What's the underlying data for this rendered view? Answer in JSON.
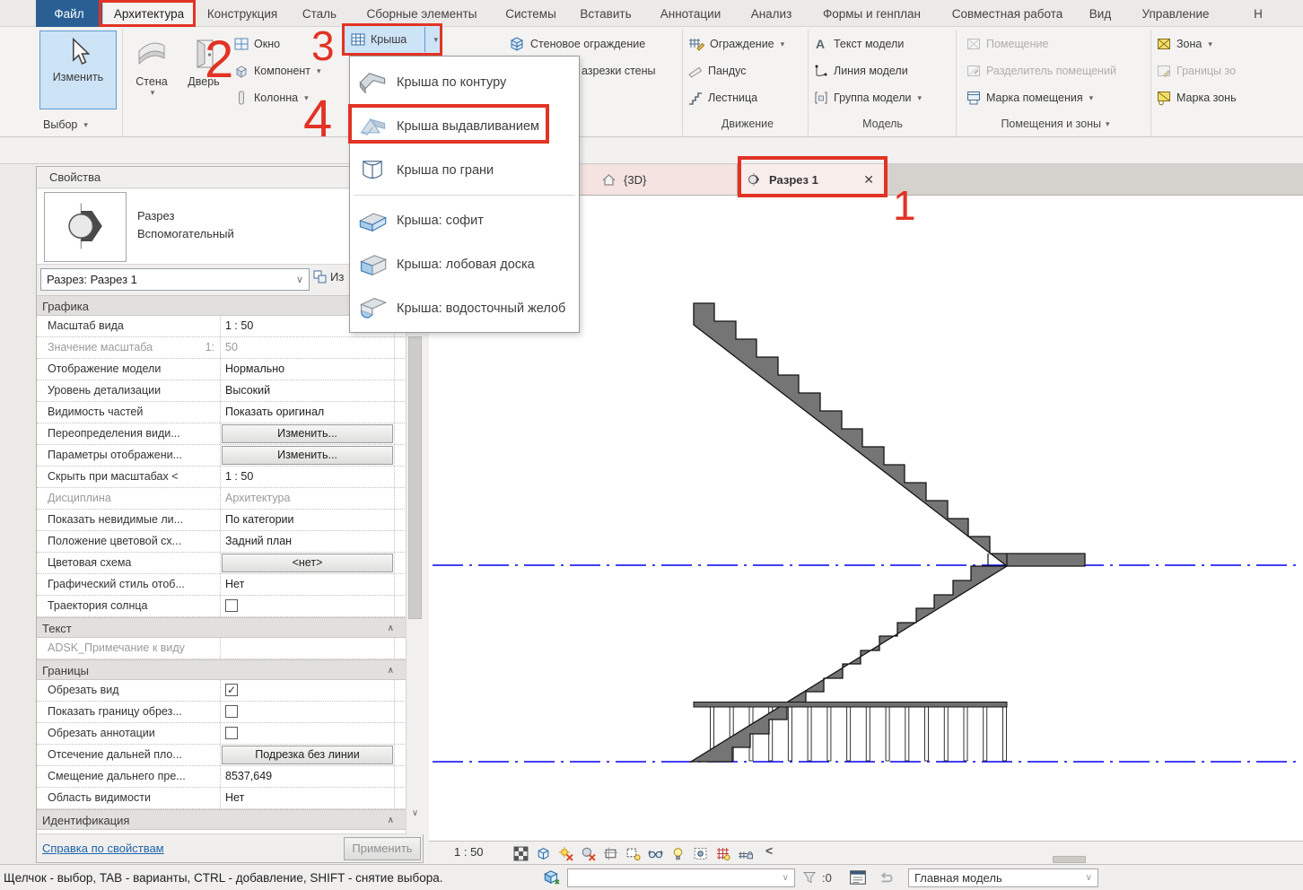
{
  "ribbon": {
    "tabs": [
      {
        "label": "Файл"
      },
      {
        "label": "Архитектура"
      },
      {
        "label": "Конструкция"
      },
      {
        "label": "Сталь"
      },
      {
        "label": "Сборные элементы"
      },
      {
        "label": "Системы"
      },
      {
        "label": "Вставить"
      },
      {
        "label": "Аннотации"
      },
      {
        "label": "Анализ"
      },
      {
        "label": "Формы и генплан"
      },
      {
        "label": "Совместная работа"
      },
      {
        "label": "Вид"
      },
      {
        "label": "Управление"
      },
      {
        "label": "Н"
      }
    ],
    "active_tab": "Архитектура",
    "modify": "Изменить",
    "selection_panel": "Выбор",
    "build": {
      "wall": "Стена",
      "door": "Дверь",
      "window": "Окно",
      "component": "Компонент",
      "column": "Колонна",
      "roof": "Крыша",
      "curtain_grid": "Стеновое ограждение",
      "wall_reveal_fragment": "азрезки стены"
    },
    "circulation": {
      "railing": "Ограждение",
      "ramp": "Пандус",
      "stair": "Лестница",
      "panel": "Движение"
    },
    "model": {
      "text": "Текст модели",
      "line": "Линия модели",
      "group": "Группа модели",
      "panel": "Модель"
    },
    "rooms": {
      "room": "Помещение",
      "separator": "Разделитель помещений",
      "room_tag": "Марка помещения",
      "panel": "Помещения и зоны",
      "zone": "Зона",
      "zone_boundary": "Границы зо",
      "zone_tag": "Марка зонь"
    }
  },
  "roof_menu": {
    "items": [
      {
        "icon": "roof-footprint",
        "label": "Крыша по контуру"
      },
      {
        "icon": "roof-extrusion",
        "label": "Крыша выдавливанием"
      },
      {
        "icon": "roof-face",
        "label": "Крыша по грани",
        "separator_after": true
      },
      {
        "icon": "roof-soffit",
        "label": "Крыша: софит"
      },
      {
        "icon": "roof-fascia",
        "label": "Крыша: лобовая доска"
      },
      {
        "icon": "roof-gutter",
        "label": "Крыша: водосточный желоб"
      }
    ]
  },
  "properties": {
    "title": "Свойства",
    "type_name": "Разрез",
    "type_style": "Вспомогательный",
    "selector": "Разрез: Разрез 1",
    "edit_type_fragment": "Из",
    "sections": [
      {
        "header": "Графика",
        "rows": [
          {
            "label": "Масштаб вида",
            "value": "1 : 50"
          },
          {
            "label": "Значение масштаба",
            "label2": "1:",
            "value": "50",
            "disabled": true
          },
          {
            "label": "Отображение модели",
            "value": "Нормально"
          },
          {
            "label": "Уровень детализации",
            "value": "Высокий"
          },
          {
            "label": "Видимость частей",
            "value": "Показать оригинал"
          },
          {
            "label": "Переопределения види...",
            "value": "Изменить...",
            "kind": "button"
          },
          {
            "label": "Параметры отображени...",
            "value": "Изменить...",
            "kind": "button"
          },
          {
            "label": "Скрыть при масштабах <",
            "value": "1 : 50"
          },
          {
            "label": "Дисциплина",
            "value": "Архитектура",
            "disabled": true
          },
          {
            "label": "Показать невидимые ли...",
            "value": "По категории"
          },
          {
            "label": "Положение цветовой сх...",
            "value": "Задний план"
          },
          {
            "label": "Цветовая схема",
            "value": "<нет>",
            "kind": "button"
          },
          {
            "label": "Графический стиль отоб...",
            "value": "Нет"
          },
          {
            "label": "Траектория солнца",
            "kind": "check",
            "checked": false
          }
        ]
      },
      {
        "header": "Текст",
        "rows": [
          {
            "label": "ADSK_Примечание к виду",
            "value": "",
            "disabled": true
          }
        ]
      },
      {
        "header": "Границы",
        "rows": [
          {
            "label": "Обрезать вид",
            "kind": "check",
            "checked": true
          },
          {
            "label": "Показать границу обрез...",
            "kind": "check",
            "checked": false
          },
          {
            "label": "Обрезать аннотации",
            "kind": "check",
            "checked": false
          },
          {
            "label": "Отсечение дальней пло...",
            "value": "Подрезка без линии",
            "kind": "button"
          },
          {
            "label": "Смещение дальнего пре...",
            "value": "8537,649"
          },
          {
            "label": "Область видимости",
            "value": "Нет"
          }
        ]
      },
      {
        "header": "Идентификация",
        "rows": []
      }
    ],
    "help_link": "Справка по свойствам",
    "apply_button": "Применить"
  },
  "view_tabs": [
    {
      "icon": "home-icon",
      "label": "{3D}"
    },
    {
      "icon": "section-icon",
      "label": "Разрез 1",
      "close": "✕",
      "active": true
    }
  ],
  "view_control_bar": {
    "scale": "1 : 50",
    "icons": [
      "crop-size",
      "visual-style",
      "sun-path-off",
      "shadows-off",
      "crop-view",
      "show-crop-region",
      "temporary-hide-isolate",
      "reveal-hidden",
      "temporary-view-properties",
      "hide-analytical",
      "view-lock"
    ],
    "collapse": "<"
  },
  "status_bar": {
    "hint": "Щелчок - выбор, TAB - варианты, CTRL - добавление, SHIFT - снятие выбора.",
    "filter_count": ":0",
    "active_model": "Главная модель"
  },
  "annotations": {
    "step1": "1",
    "step2": "2",
    "step3": "3",
    "step4": "4"
  },
  "colors": {
    "accent_red": "#e23325",
    "level_line_blue": "#0000f2",
    "stair_gray": "#757575"
  }
}
